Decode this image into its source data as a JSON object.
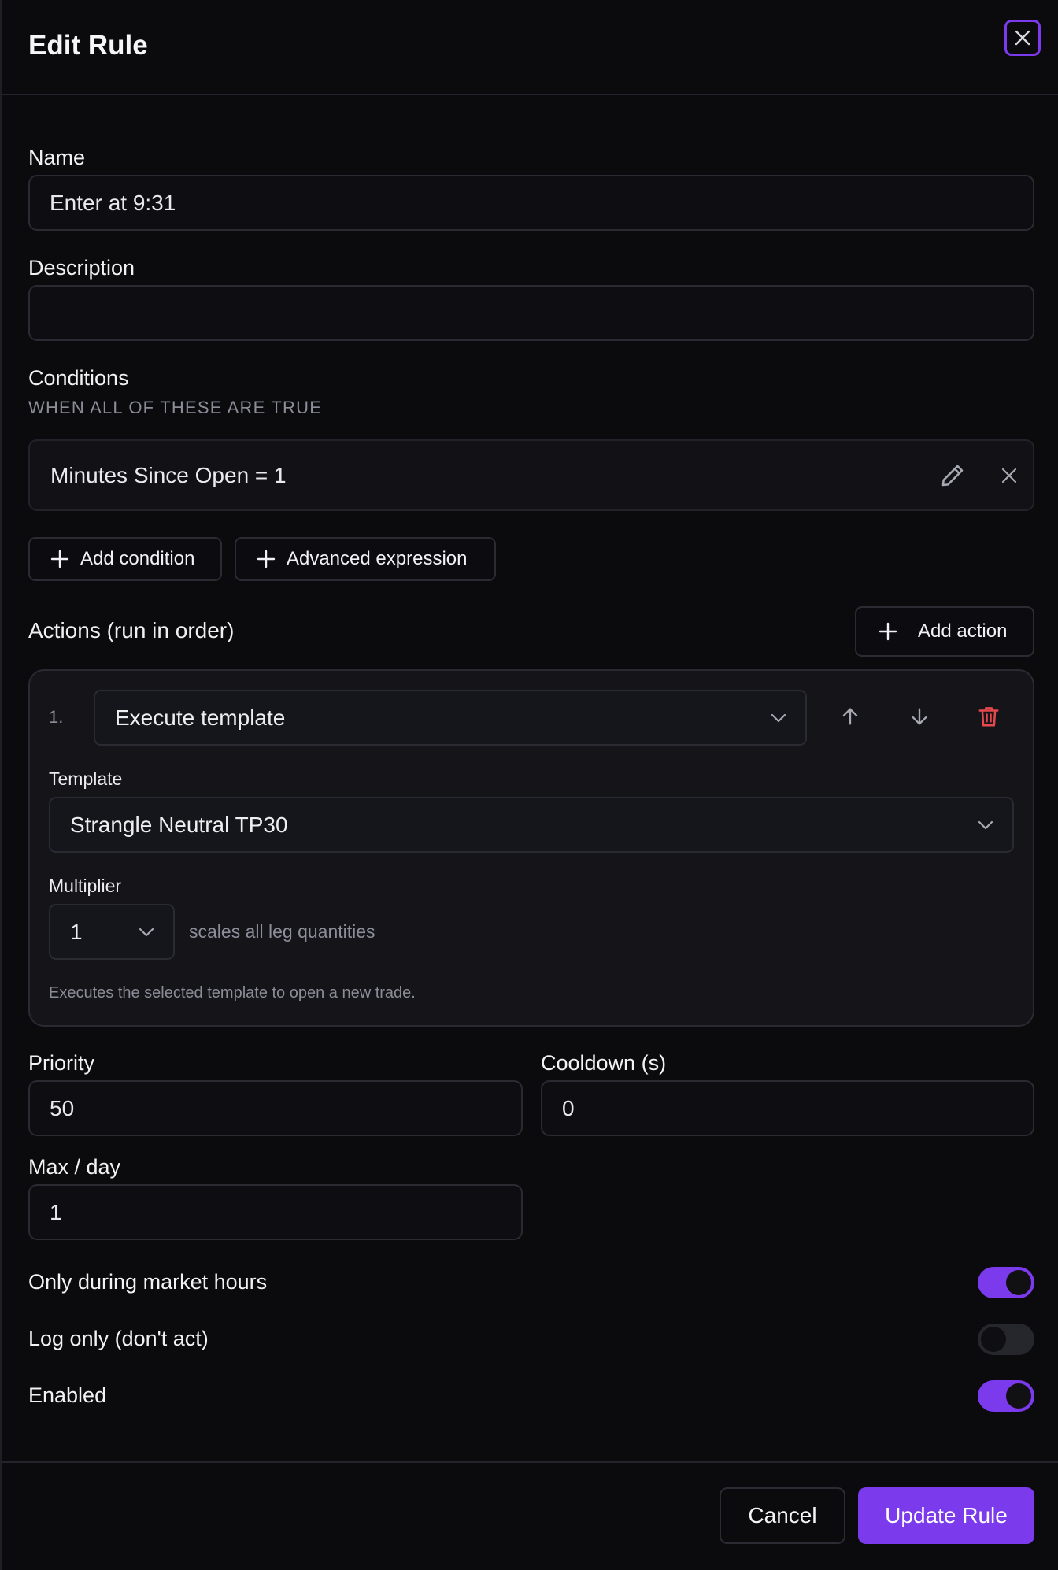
{
  "dialog": {
    "title": "Edit Rule"
  },
  "name": {
    "label": "Name",
    "value": "Enter at 9:31"
  },
  "description": {
    "label": "Description",
    "value": ""
  },
  "conditions": {
    "label": "Conditions",
    "sublabel": "WHEN ALL OF THESE ARE TRUE",
    "items": [
      {
        "text": "Minutes Since Open = 1"
      }
    ],
    "add_condition_label": "Add condition",
    "advanced_expression_label": "Advanced expression"
  },
  "actions": {
    "title": "Actions (run in order)",
    "add_action_label": "Add action",
    "items": [
      {
        "index": "1.",
        "type": "Execute template",
        "template_label": "Template",
        "template_value": "Strangle Neutral TP30",
        "multiplier_label": "Multiplier",
        "multiplier_value": "1",
        "multiplier_hint": "scales all leg quantities",
        "description": "Executes the selected template to open a new trade."
      }
    ]
  },
  "priority": {
    "label": "Priority",
    "value": "50"
  },
  "cooldown": {
    "label": "Cooldown (s)",
    "value": "0"
  },
  "max_per_day": {
    "label": "Max / day",
    "value": "1"
  },
  "toggles": {
    "market_hours": {
      "label": "Only during market hours",
      "on": true
    },
    "log_only": {
      "label": "Log only (don't act)",
      "on": false
    },
    "enabled": {
      "label": "Enabled",
      "on": true
    }
  },
  "footer": {
    "cancel_label": "Cancel",
    "submit_label": "Update Rule"
  },
  "colors": {
    "accent": "#7c3aed",
    "danger": "#e5484d",
    "background": "#0b0b0e"
  },
  "icons": [
    "close-icon",
    "pencil-icon",
    "x-icon",
    "plus-icon",
    "chevron-down-icon",
    "arrow-up-icon",
    "arrow-down-icon",
    "trash-icon"
  ]
}
